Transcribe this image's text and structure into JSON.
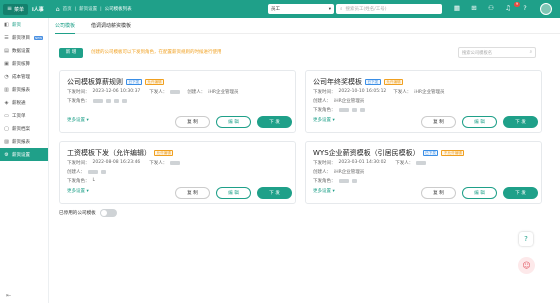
{
  "topbar": {
    "menu_label": "菜单",
    "brand": "i人事",
    "breadcrumbs": [
      "首页",
      "薪资设置",
      "公司模板列表"
    ],
    "role_select": "员工",
    "search_placeholder": "搜索员工(姓名/工号)",
    "notification_count": "9",
    "icons": [
      "calendar-icon",
      "grid-icon",
      "people-icon",
      "bell-icon",
      "help-icon",
      "search-icon"
    ]
  },
  "sidebar": {
    "items": [
      {
        "label": "薪资",
        "icon": "wallet-icon",
        "main": true
      },
      {
        "label": "薪资项目",
        "icon": "list-icon",
        "new": "NEW"
      },
      {
        "label": "数据设置",
        "icon": "data-icon"
      },
      {
        "label": "薪资核算",
        "icon": "calc-icon"
      },
      {
        "label": "成本管理",
        "icon": "cost-icon"
      },
      {
        "label": "薪资报表",
        "icon": "report-icon"
      },
      {
        "label": "薪税通",
        "icon": "tax-icon"
      },
      {
        "label": "工资单",
        "icon": "payslip-icon"
      },
      {
        "label": "薪资档案",
        "icon": "archive-icon"
      },
      {
        "label": "薪资报表",
        "icon": "chart-icon"
      },
      {
        "label": "薪资设置",
        "icon": "settings-icon",
        "active": true
      }
    ]
  },
  "tabs": [
    {
      "label": "公司模板",
      "active": true
    },
    {
      "label": "借调调动薪资模板",
      "active": false
    }
  ],
  "toolbar": {
    "new_label": "新 增",
    "tip": "创建的公司模板可以下发到角色，在配置薪资规则的时候进行使用",
    "search_placeholder": "搜索公司模板名"
  },
  "cards": [
    {
      "title": "公司模板算薪规则",
      "tags": [
        {
          "text": "已下发",
          "color": "blue"
        },
        {
          "text": "允许编辑",
          "color": "orange"
        }
      ],
      "issue_time_label": "下发时间：",
      "issue_time": "2023-12-06 10:30:37",
      "issuer_label": "下发人：",
      "creator_label": "创建人：",
      "creator": "iHR企业管理员",
      "target_label": "下发角色：",
      "more": "更多设置",
      "copy": "复 制",
      "edit": "编 辑",
      "issue": "下 发"
    },
    {
      "title": "公司年终奖模板",
      "tags": [
        {
          "text": "已下发",
          "color": "blue"
        },
        {
          "text": "允许编辑",
          "color": "orange"
        }
      ],
      "issue_time_label": "下发时间：",
      "issue_time": "2022-10-10 16:05:12",
      "issuer_label": "下发人：",
      "issuer": "iHR企业管理员",
      "creator_label": "创建人：",
      "creator": "iHR企业管理员",
      "target_label": "下发角色：",
      "more": "更多设置",
      "copy": "复 制",
      "edit": "编 辑",
      "issue": "下 发"
    },
    {
      "title": "工资模板下发（允许编辑）",
      "tags": [
        {
          "text": "允许编辑",
          "color": "orange"
        }
      ],
      "issue_time_label": "下发时间：",
      "issue_time": "2022-08-08 16:23:46",
      "issuer_label": "下发人：",
      "creator_label": "创建人：",
      "target_label": "下发角色：",
      "target_tail": "L",
      "more": "更多设置",
      "copy": "复 制",
      "edit": "编 辑",
      "issue": "下 发"
    },
    {
      "title": "WYS企业薪资模板（引居民模板）",
      "tags": [
        {
          "text": "已下发",
          "color": "blue"
        },
        {
          "text": "不允许编辑",
          "color": "orange"
        }
      ],
      "issue_time_label": "下发时间：",
      "issue_time": "2023-03-01 14:30:02",
      "issuer_label": "下发人：",
      "creator_label": "创建人：",
      "creator": "iHR企业管理员",
      "target_label": "下发角色：",
      "more": "更多设置",
      "copy": "复 制",
      "edit": "编 辑",
      "issue": "下 发"
    }
  ],
  "disabled_toggle_label": "已停用的公司模板"
}
